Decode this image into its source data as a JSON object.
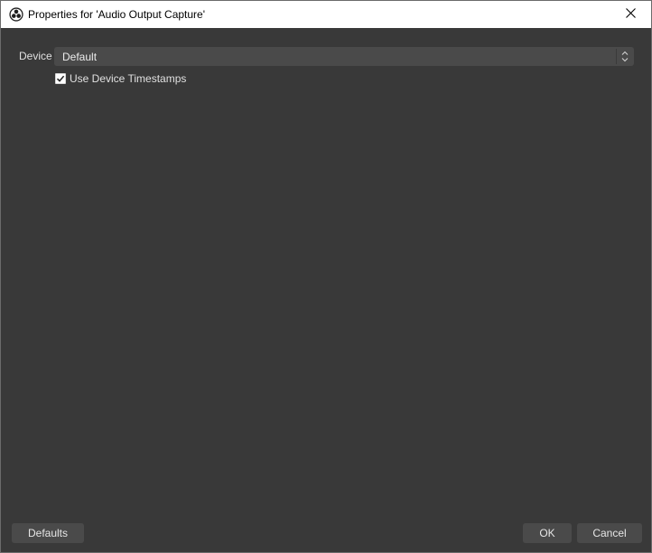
{
  "window": {
    "title": "Properties for 'Audio Output Capture'",
    "app_icon": "obs-logo-icon",
    "close_icon": "close-icon"
  },
  "properties": {
    "device": {
      "label": "Device",
      "selected": "Default",
      "icon": "updown-chevron-icon"
    },
    "use_device_timestamps": {
      "label": "Use Device Timestamps",
      "checked": true
    }
  },
  "buttons": {
    "defaults": "Defaults",
    "ok": "OK",
    "cancel": "Cancel"
  },
  "colors": {
    "background": "#393939",
    "control": "#4a4a4a",
    "text": "#e0e0e0",
    "titlebar": "#ffffff"
  }
}
